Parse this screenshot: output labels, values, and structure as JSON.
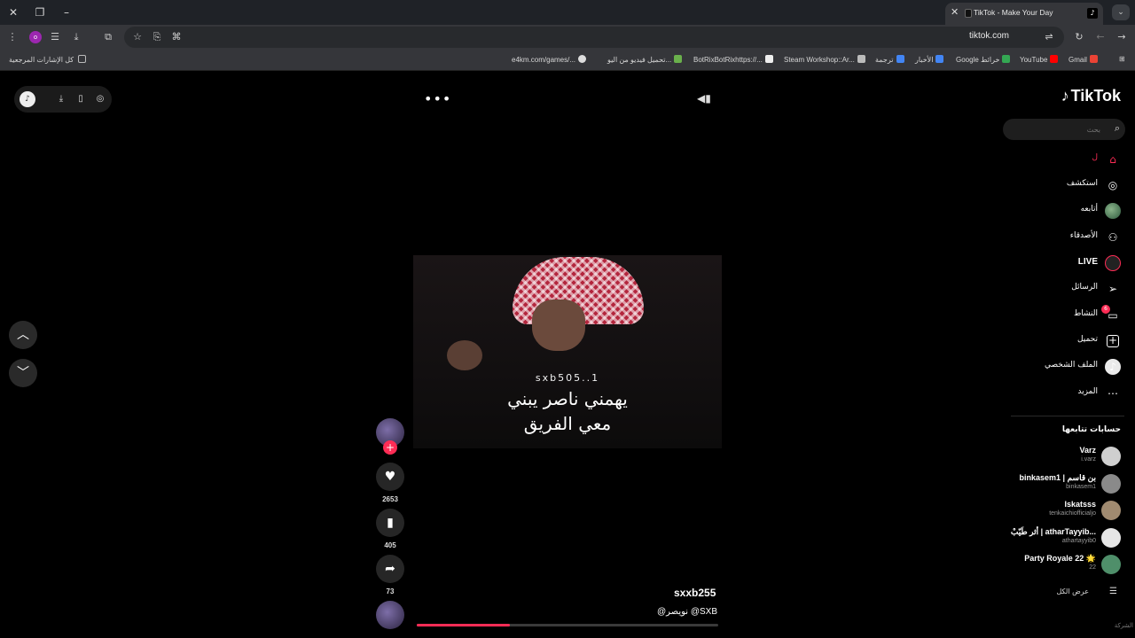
{
  "browser": {
    "tab_title": "TikTok - Make Your Day",
    "url": "tiktok.com",
    "profile_initial": "o",
    "bookmarks": [
      {
        "label": "Gmail",
        "color": "#ea4335"
      },
      {
        "label": "YouTube",
        "color": "#ff0000"
      },
      {
        "label": "Google خرائط",
        "color": "#34a853"
      },
      {
        "label": "الأخبار",
        "color": "#4285f4"
      },
      {
        "label": "ترجمة",
        "color": "#4285f4"
      },
      {
        "label": "Steam Workshop::Ar...",
        "color": "#1b2838"
      },
      {
        "label": "BotRixBotRixhttps://...",
        "color": "#eeeeee"
      },
      {
        "label": "تحميل فيديو من اليو...",
        "color": "#6ab04c"
      },
      {
        "label": "e4km.com/games/...",
        "color": "#dddddd"
      }
    ],
    "all_bookmarks_label": "كل الإشارات المرجعية"
  },
  "player": {
    "caption_username": "sxb505..1",
    "caption_line1": "يهمني ناصر يبني",
    "caption_line2": "معي الفريق",
    "author": "sxxb255",
    "description": "@نويصر @SXB",
    "progress": 0.31,
    "likes": "2653",
    "saves": "405",
    "shares": "73"
  },
  "sidebar": {
    "logo": "TikTok",
    "search_placeholder": "بحث",
    "nav": [
      {
        "name": "home",
        "label": "ل",
        "icon": "⌂"
      },
      {
        "name": "explore",
        "label": "استكشف",
        "icon": "◎"
      },
      {
        "name": "following",
        "label": "أتابعه",
        "icon": ""
      },
      {
        "name": "friends",
        "label": "الأصدقاء",
        "icon": "⚇"
      },
      {
        "name": "live",
        "label": "LIVE",
        "icon": "◉"
      },
      {
        "name": "messages",
        "label": "الرسائل",
        "icon": "➢"
      },
      {
        "name": "activity",
        "label": "النشاط",
        "icon": "▭"
      },
      {
        "name": "upload",
        "label": "تحميل",
        "icon": "+"
      },
      {
        "name": "profile",
        "label": "الملف الشخصي",
        "icon": ""
      },
      {
        "name": "more",
        "label": "المزيد",
        "icon": "⋯"
      }
    ],
    "activity_badge": "6",
    "following_title": "حسابات تتابعها",
    "following": [
      {
        "name": "Varz",
        "handle": "i.varz",
        "color": "#cfcfcf"
      },
      {
        "name": "binkasem1 | بن قاسم",
        "handle": "binkasem1",
        "color": "#8a8a8a"
      },
      {
        "name": "Iskatsss",
        "handle": "tenkaichiofficialjo",
        "color": "#a08a70"
      },
      {
        "name": "أثر طَيّبْ | atharTayyib...",
        "handle": "athartayyib0",
        "color": "#e6e6e6"
      },
      {
        "name": "Party Royale 22 🌟",
        "handle": "22",
        "color": "#4f8f6a"
      }
    ],
    "see_all": "عرض الكل",
    "corner_text": "الشركة"
  }
}
